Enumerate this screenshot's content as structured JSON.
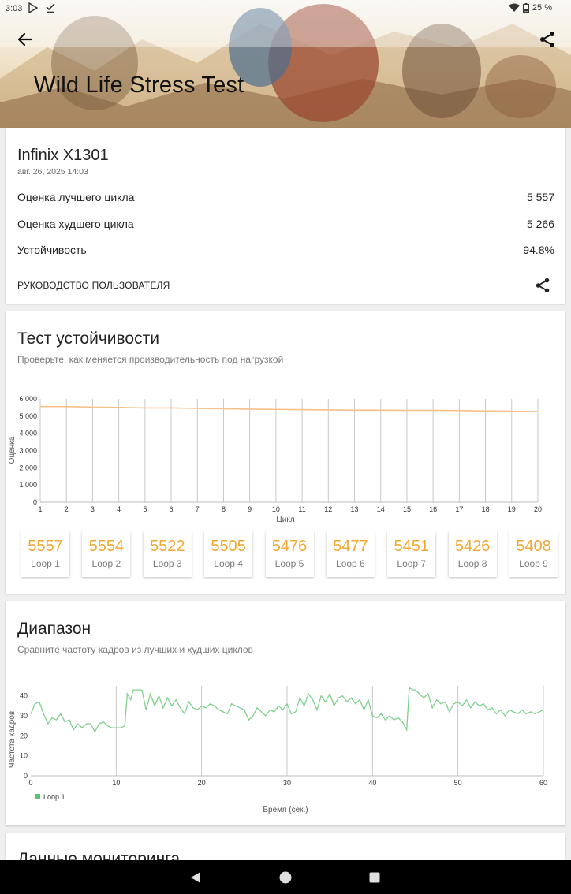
{
  "status_bar": {
    "time": "3:03",
    "battery": "25 %",
    "icons": [
      "play-store-icon",
      "download-done-icon",
      "wifi-icon",
      "battery-icon"
    ]
  },
  "header": {
    "title": "Wild Life Stress Test",
    "icons": [
      "back-arrow-icon",
      "share-icon"
    ]
  },
  "summary": {
    "device_name": "Infinix X1301",
    "date": "авг. 26, 2025 14:03",
    "rows": [
      {
        "label": "Оценка лучшего цикла",
        "value": "5 557"
      },
      {
        "label": "Оценка худшего цикла",
        "value": "5 266"
      },
      {
        "label": "Устойчивость",
        "value": "94.8%"
      }
    ],
    "guide_link": "РУКОВОДСТВО ПОЛЬЗОВАТЕЛЯ"
  },
  "stability": {
    "title": "Тест устойчивости",
    "subtitle": "Проверьте, как меняется производительность под нагрузкой",
    "loops": [
      {
        "score": "5557",
        "label": "Loop 1"
      },
      {
        "score": "5554",
        "label": "Loop 2"
      },
      {
        "score": "5522",
        "label": "Loop 3"
      },
      {
        "score": "5505",
        "label": "Loop 4"
      },
      {
        "score": "5476",
        "label": "Loop 5"
      },
      {
        "score": "5477",
        "label": "Loop 6"
      },
      {
        "score": "5451",
        "label": "Loop 7"
      },
      {
        "score": "5426",
        "label": "Loop 8"
      },
      {
        "score": "5408",
        "label": "Loop 9"
      }
    ]
  },
  "range": {
    "title": "Диапазон",
    "subtitle": "Сравните частоту кадров из лучших и худших циклов"
  },
  "monitoring": {
    "title": "Данные мониторинга"
  },
  "colors": {
    "accent": "#f0a832",
    "score_line": "#f5c08a",
    "fps_line": "#7fd08e",
    "legend_swatch": "#5cc374"
  },
  "chart_data": [
    {
      "type": "line",
      "xlabel": "Цикл",
      "ylabel": "Оценка",
      "x": [
        1,
        2,
        3,
        4,
        5,
        6,
        7,
        8,
        9,
        10,
        11,
        12,
        13,
        14,
        15,
        16,
        17,
        18,
        19,
        20
      ],
      "ylim": [
        0,
        6000
      ],
      "y_ticks": [
        "0",
        "1 000",
        "2 000",
        "3 000",
        "4 000",
        "5 000",
        "6 000"
      ],
      "y_tick_values": [
        0,
        1000,
        2000,
        3000,
        4000,
        5000,
        6000
      ],
      "series": [
        {
          "values": [
            5557,
            5554,
            5522,
            5505,
            5476,
            5477,
            5451,
            5426,
            5408,
            5390,
            5375,
            5365,
            5350,
            5345,
            5338,
            5330,
            5325,
            5300,
            5285,
            5266
          ]
        }
      ],
      "grid": "vertical"
    },
    {
      "type": "line",
      "xlabel": "Время (сек.)",
      "ylabel": "Частота кадров",
      "xlim": [
        0,
        60
      ],
      "ylim": [
        0,
        45
      ],
      "x_ticks": [
        0,
        10,
        20,
        30,
        40,
        50,
        60
      ],
      "y_ticks": [
        0,
        10,
        20,
        30,
        40
      ],
      "legend": [
        "Loop 1"
      ],
      "legend_position": "bottom-left",
      "grid": "vertical",
      "series": [
        {
          "name": "Loop 1",
          "x": [
            0,
            0.5,
            1,
            1.5,
            2,
            2.5,
            3,
            3.5,
            4,
            4.5,
            5,
            5.5,
            6,
            6.5,
            7,
            7.5,
            8,
            8.5,
            9,
            9.5,
            10,
            10.5,
            11,
            11.3,
            11.7,
            12,
            12.5,
            13,
            13.5,
            14,
            14.5,
            15,
            15.5,
            16,
            16.5,
            17,
            17.5,
            18,
            18.5,
            19,
            19.5,
            20,
            20.5,
            21,
            21.5,
            22,
            22.5,
            23,
            23.5,
            24,
            24.5,
            25,
            25.5,
            26,
            26.5,
            27,
            27.5,
            28,
            28.5,
            29,
            29.5,
            30,
            30.5,
            31,
            31.5,
            32,
            32.5,
            33,
            33.5,
            34,
            34.5,
            35,
            35.5,
            36,
            36.5,
            37,
            37.5,
            38,
            38.5,
            39,
            39.5,
            40,
            40.5,
            41,
            41.5,
            42,
            42.5,
            43,
            43.5,
            44,
            44.3,
            44.7,
            45,
            45.5,
            46,
            46.5,
            47,
            47.5,
            48,
            48.5,
            49,
            49.5,
            50,
            50.5,
            51,
            51.5,
            52,
            52.5,
            53,
            53.5,
            54,
            54.5,
            55,
            55.5,
            56,
            56.5,
            57,
            57.5,
            58,
            58.5,
            59,
            59.5,
            60
          ],
          "values": [
            31,
            36,
            37,
            31,
            26,
            29,
            28,
            31,
            27,
            28,
            23,
            26,
            24,
            26,
            26,
            22,
            26,
            27,
            25,
            24,
            24,
            24,
            25,
            41,
            38,
            43,
            43,
            43,
            33,
            41,
            35,
            40,
            34,
            39,
            35,
            38,
            34,
            31,
            37,
            34,
            33,
            35,
            34,
            36,
            35,
            33,
            32,
            31,
            36,
            35,
            34,
            33,
            28,
            30,
            34,
            32,
            30,
            33,
            32,
            35,
            33,
            36,
            31,
            32,
            39,
            35,
            41,
            38,
            33,
            40,
            37,
            41,
            35,
            39,
            40,
            37,
            39,
            36,
            38,
            33,
            38,
            30,
            29,
            31,
            28,
            30,
            28,
            29,
            27,
            23,
            44,
            43,
            43,
            41,
            39,
            41,
            34,
            38,
            36,
            37,
            32,
            36,
            37,
            35,
            38,
            34,
            37,
            35,
            36,
            33,
            34,
            31,
            33,
            30,
            33,
            32,
            31,
            33,
            31,
            32,
            31,
            32,
            33
          ]
        }
      ]
    }
  ]
}
